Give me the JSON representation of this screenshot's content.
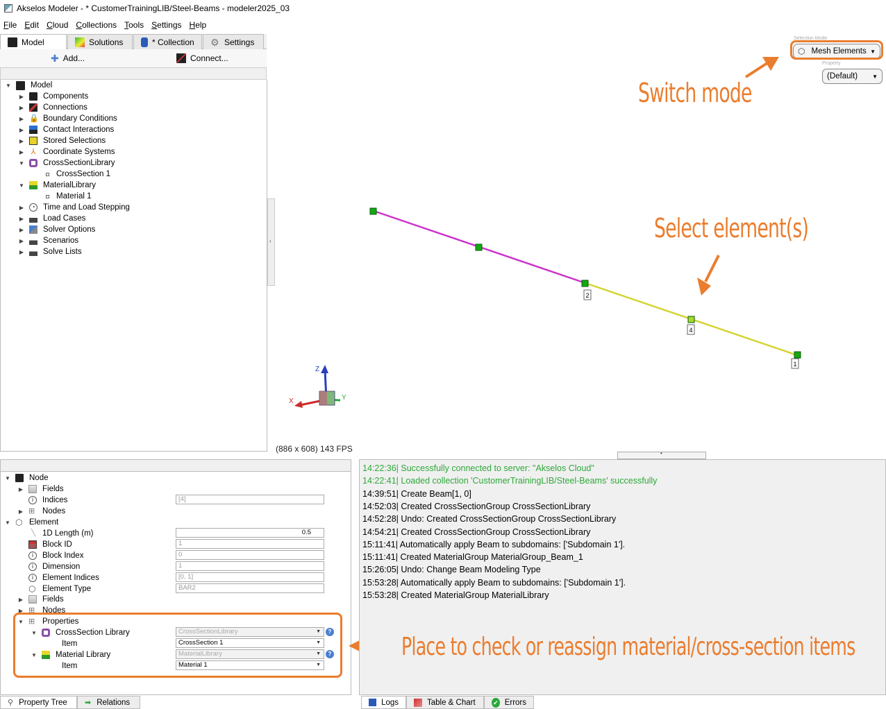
{
  "window": {
    "title": "Akselos Modeler - * CustomerTrainingLIB/Steel-Beams - modeler2025_03"
  },
  "menu": [
    "File",
    "Edit",
    "Cloud",
    "Collections",
    "Tools",
    "Settings",
    "Help"
  ],
  "tabs": [
    {
      "label": "Model",
      "active": true
    },
    {
      "label": "Solutions",
      "active": false
    },
    {
      "label": "* Collection",
      "active": false
    },
    {
      "label": "Settings",
      "active": false
    }
  ],
  "toolbar": {
    "add": "Add...",
    "connect": "Connect..."
  },
  "tree": {
    "root": "Model",
    "items": [
      {
        "label": "Components",
        "icon": "component-icon"
      },
      {
        "label": "Connections",
        "icon": "connection-icon"
      },
      {
        "label": "Boundary Conditions",
        "icon": "lock-icon"
      },
      {
        "label": "Contact Interactions",
        "icon": "contact-icon"
      },
      {
        "label": "Stored Selections",
        "icon": "selection-icon"
      },
      {
        "label": "Coordinate Systems",
        "icon": "axes-icon"
      },
      {
        "label": "CrossSectionLibrary",
        "icon": "crosssection-icon",
        "child": "CrossSection 1"
      },
      {
        "label": "MaterialLibrary",
        "icon": "material-icon",
        "child": "Material 1"
      },
      {
        "label": "Time and Load Stepping",
        "icon": "clock-icon"
      },
      {
        "label": "Load Cases",
        "icon": "factory-icon"
      },
      {
        "label": "Solver Options",
        "icon": "solver-icon"
      },
      {
        "label": "Scenarios",
        "icon": "factory-icon"
      },
      {
        "label": "Solve Lists",
        "icon": "factory-icon"
      }
    ]
  },
  "viewport": {
    "selection_mode_label": "Selection Mode",
    "selection_mode": "Mesh Elements",
    "property_label": "Property",
    "property": "(Default)",
    "fps": "(886 x 608) 143 FPS",
    "node_labels": [
      "2",
      "4",
      "1"
    ],
    "axis_labels": {
      "z": "Z",
      "x": "X",
      "y": "Y"
    },
    "colors": {
      "selected": "#cc33cc",
      "unselected": "#d4d432",
      "node": "#11aa11",
      "annotation": "#ea7d2e"
    }
  },
  "annotations": {
    "switch_mode": "Switch mode",
    "select_elements": "Select element(s)",
    "place_to_check": "Place to check or reassign material/cross-section items"
  },
  "properties": {
    "node": {
      "label": "Node",
      "fields": "Fields",
      "indices": "Indices",
      "indices_value": "[4]",
      "nodes": "Nodes"
    },
    "element": {
      "label": "Element",
      "length_label": "1D Length (m)",
      "length_value": "0.5",
      "block_id_label": "Block ID",
      "block_id_value": "1",
      "block_index_label": "Block Index",
      "block_index_value": "0",
      "dimension_label": "Dimension",
      "dimension_value": "1",
      "element_indices_label": "Element Indices",
      "element_indices_value": "[0, 1]",
      "element_type_label": "Element Type",
      "element_type_value": "BAR2",
      "fields": "Fields",
      "nodes": "Nodes"
    },
    "props": {
      "label": "Properties",
      "cs_lib_label": "CrossSection Library",
      "cs_lib_value": "CrossSectionLibrary",
      "cs_item_label": "Item",
      "cs_item_value": "CrossSection 1",
      "mat_lib_label": "Material Library",
      "mat_lib_value": "MaterialLibrary",
      "mat_item_label": "Item",
      "mat_item_value": "Material 1"
    }
  },
  "logs": [
    {
      "text": "14:22:36| Successfully connected to server: \"Akselos Cloud\"",
      "ok": true
    },
    {
      "text": "14:22:41| Loaded collection 'CustomerTrainingLIB/Steel-Beams' successfully",
      "ok": true
    },
    {
      "text": "14:39:51| Create Beam[1, 0]",
      "ok": false
    },
    {
      "text": "14:52:03| Created CrossSectionGroup CrossSectionLibrary",
      "ok": false
    },
    {
      "text": "14:52:28| Undo: Created CrossSectionGroup CrossSectionLibrary",
      "ok": false
    },
    {
      "text": "14:54:21| Created CrossSectionGroup CrossSectionLibrary",
      "ok": false
    },
    {
      "text": "15:11:41| Automatically apply Beam to subdomains: ['Subdomain 1'].",
      "ok": false
    },
    {
      "text": "15:11:41| Created MaterialGroup MaterialGroup_Beam_1",
      "ok": false
    },
    {
      "text": "15:26:05| Undo: Change Beam Modeling Type",
      "ok": false
    },
    {
      "text": "15:53:28| Automatically apply Beam to subdomains: ['Subdomain 1'].",
      "ok": false
    },
    {
      "text": "15:53:28| Created MaterialGroup MaterialLibrary",
      "ok": false
    }
  ],
  "bottom_tabs_left": [
    "Property Tree",
    "Relations"
  ],
  "bottom_tabs_right": [
    "Logs",
    "Table & Chart",
    "Errors"
  ]
}
